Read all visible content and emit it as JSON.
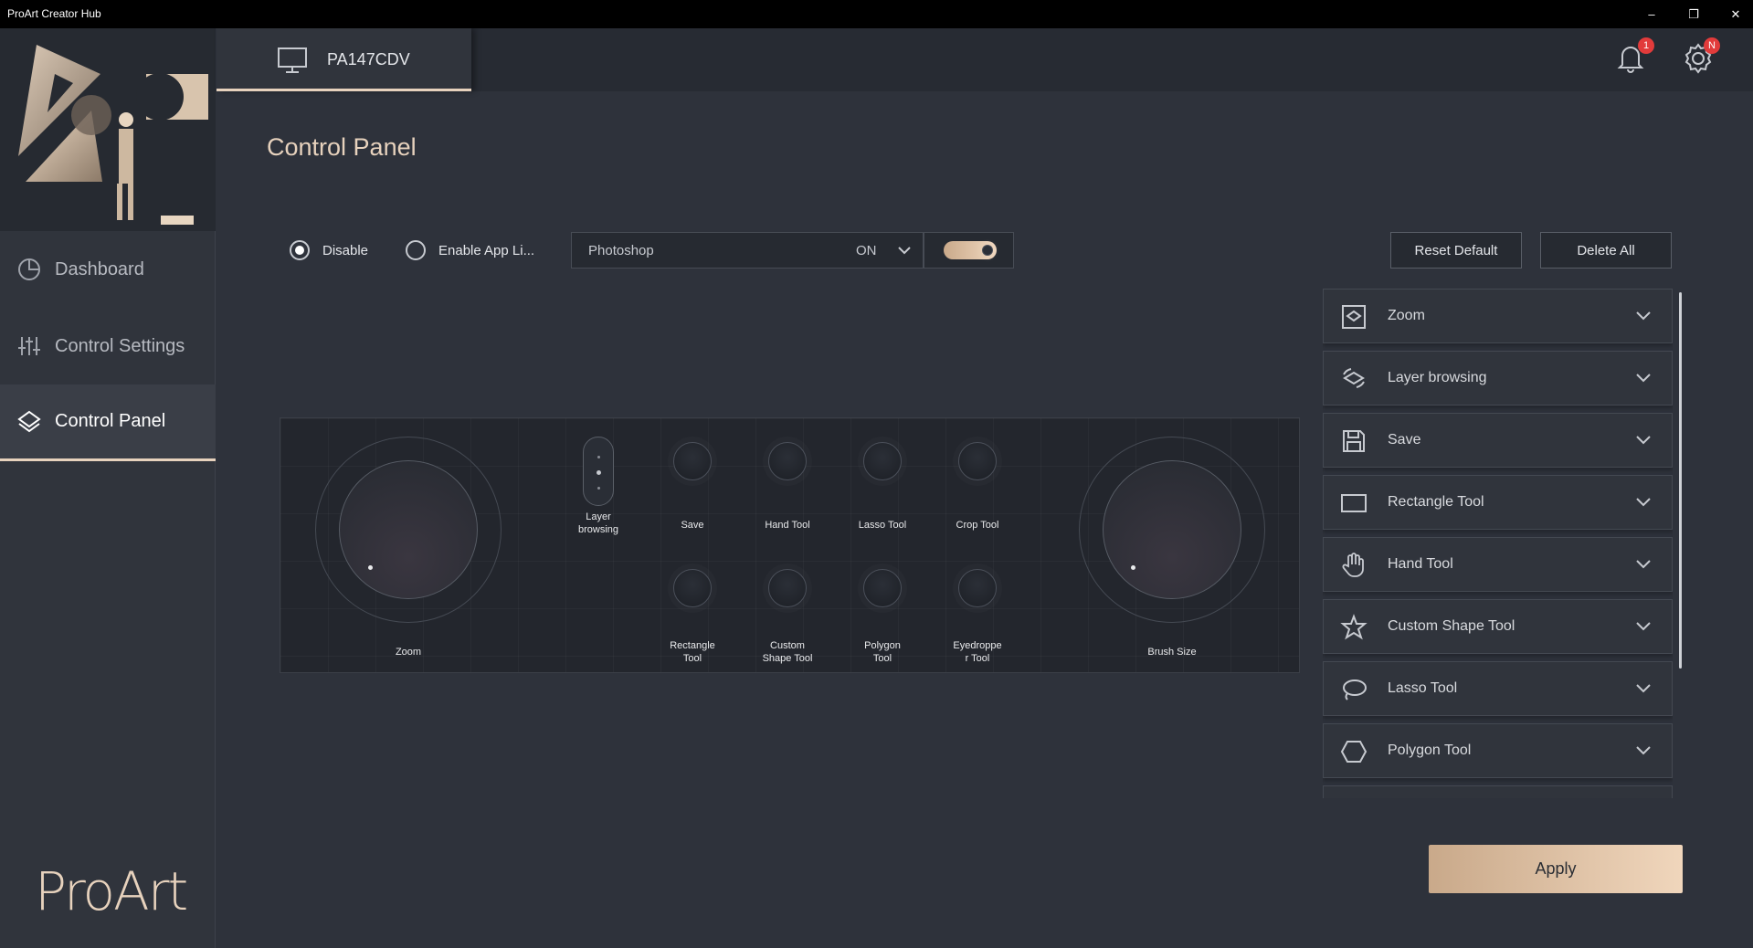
{
  "window": {
    "title": "ProArt Creator Hub"
  },
  "sidebar": {
    "items": [
      {
        "label": "Dashboard",
        "icon": "pie-chart-icon"
      },
      {
        "label": "Control Settings",
        "icon": "sliders-icon"
      },
      {
        "label": "Control Panel",
        "icon": "layers-diamond-icon"
      }
    ],
    "active": "Control Panel",
    "brand": "ProArt"
  },
  "header": {
    "device_name": "PA147CDV",
    "notifications_badge": "1",
    "settings_badge": "N"
  },
  "main": {
    "title": "Control Panel",
    "mode_options": [
      {
        "label": "Disable",
        "selected": true
      },
      {
        "label": "Enable App Li...",
        "selected": false
      }
    ],
    "app_select": {
      "value": "Photoshop",
      "status": "ON"
    },
    "toggle_on": true,
    "reset_label": "Reset Default",
    "delete_label": "Delete All",
    "apply_label": "Apply"
  },
  "device": {
    "left_dial": "Zoom",
    "right_dial": "Brush Size",
    "rocker": "Layer browsing",
    "top_keys": [
      "Save",
      "Hand Tool",
      "Lasso Tool",
      "Crop Tool"
    ],
    "bottom_keys": [
      "Rectangle Tool",
      "Custom Shape Tool",
      "Polygon Tool",
      "Eyedropper Tool"
    ],
    "bottom_keys_display": [
      "Rectangle\nTool",
      "Custom\nShape Tool",
      "Polygon\nTool",
      "Eyedroppe\nr Tool"
    ]
  },
  "function_list": [
    {
      "label": "Zoom",
      "icon": "zoom-frame-icon"
    },
    {
      "label": "Layer browsing",
      "icon": "layer-browse-icon"
    },
    {
      "label": "Save",
      "icon": "save-icon"
    },
    {
      "label": "Rectangle Tool",
      "icon": "rectangle-icon"
    },
    {
      "label": "Hand Tool",
      "icon": "hand-icon"
    },
    {
      "label": "Custom Shape Tool",
      "icon": "star-shape-icon"
    },
    {
      "label": "Lasso Tool",
      "icon": "lasso-icon"
    },
    {
      "label": "Polygon Tool",
      "icon": "hexagon-icon"
    }
  ],
  "colors": {
    "accent": "#e7d2bd",
    "background": "#2e323b",
    "badge": "#e23b3b"
  }
}
